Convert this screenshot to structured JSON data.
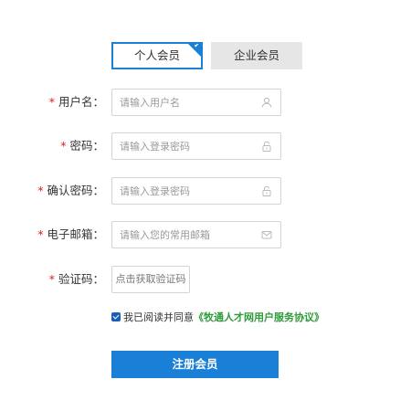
{
  "tabs": {
    "personal_label": "个人会员",
    "enterprise_label": "企业会员"
  },
  "form": {
    "username": {
      "label": "用户名：",
      "placeholder": "请输入用户名",
      "icon": "user-icon"
    },
    "password": {
      "label": "密码：",
      "placeholder": "请输入登录密码",
      "icon": "lock-icon"
    },
    "confirm_password": {
      "label": "确认密码：",
      "placeholder": "请输入登录密码",
      "icon": "lock-icon"
    },
    "email": {
      "label": "电子邮箱：",
      "placeholder": "请输入您的常用邮箱",
      "icon": "mail-icon"
    },
    "captcha": {
      "label": "验证码：",
      "button_label": "点击获取验证码"
    },
    "required_mark": "*"
  },
  "agreement": {
    "text": "我已阅读并同意",
    "link_text": "《牧通人才网用户服务协议》",
    "checked": true
  },
  "submit_label": "注册会员",
  "colors": {
    "accent": "#1a7fd6",
    "required": "#d62020",
    "link": "#2f9a3a",
    "inactive_tab": "#e6e6e6"
  }
}
